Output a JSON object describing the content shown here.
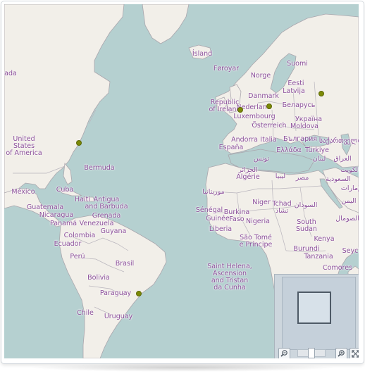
{
  "map": {
    "labels": [
      {
        "id": "island",
        "text": "Ísland"
      },
      {
        "id": "foroyar",
        "text": "Føroyar"
      },
      {
        "id": "norge",
        "text": "Norge"
      },
      {
        "id": "suomi",
        "text": "Suomi"
      },
      {
        "id": "eesti",
        "text": "Eesti"
      },
      {
        "id": "latvija",
        "text": "Latvija"
      },
      {
        "id": "danmark",
        "text": "Danmark"
      },
      {
        "id": "nederland",
        "text": "Nederland"
      },
      {
        "id": "belarus",
        "text": "Беларусь"
      },
      {
        "id": "ireland",
        "text": "Republic\nof Ireland"
      },
      {
        "id": "luxembourg",
        "text": "Luxembourg"
      },
      {
        "id": "ukraina",
        "text": "Україна"
      },
      {
        "id": "osterreich",
        "text": "Österreich"
      },
      {
        "id": "moldova",
        "text": "Moldova"
      },
      {
        "id": "bulgaria",
        "text": "България"
      },
      {
        "id": "andorra",
        "text": "Andorra"
      },
      {
        "id": "italia",
        "text": "Italia"
      },
      {
        "id": "georgia",
        "text": "საქართველო"
      },
      {
        "id": "espana",
        "text": "España"
      },
      {
        "id": "ellada",
        "text": "Ελλάδα"
      },
      {
        "id": "turkiye",
        "text": "Türkiye"
      },
      {
        "id": "tunisia",
        "text": "تونس"
      },
      {
        "id": "lebanon",
        "text": "لبنان"
      },
      {
        "id": "iraq",
        "text": "العراق"
      },
      {
        "id": "algeria",
        "text": "الجزائر\nAlgérie"
      },
      {
        "id": "libya",
        "text": "ليبيا"
      },
      {
        "id": "kuwait",
        "text": "الكويت"
      },
      {
        "id": "egypt",
        "text": "مصر"
      },
      {
        "id": "saudi",
        "text": "السعودية"
      },
      {
        "id": "morocco",
        "text": "موريتانيا"
      },
      {
        "id": "uae",
        "text": "الإمارات"
      },
      {
        "id": "yemen",
        "text": "اليمن"
      },
      {
        "id": "niger",
        "text": "Niger"
      },
      {
        "id": "tchad",
        "text": "Tchad\nتشاد"
      },
      {
        "id": "sudan",
        "text": "السودان"
      },
      {
        "id": "somalia",
        "text": "الصومال"
      },
      {
        "id": "senegal",
        "text": "Sénégal"
      },
      {
        "id": "burkina",
        "text": "Burkina\nFaso"
      },
      {
        "id": "guinee",
        "text": "Guinée"
      },
      {
        "id": "nigeria",
        "text": "Nigeria"
      },
      {
        "id": "liberia",
        "text": "Liberia"
      },
      {
        "id": "south_sudan",
        "text": "South\nSudan"
      },
      {
        "id": "kenya",
        "text": "Kenya"
      },
      {
        "id": "saotome",
        "text": "São Tomé\ne Príncipe"
      },
      {
        "id": "burundi",
        "text": "Burundi"
      },
      {
        "id": "tanzania",
        "text": "Tanzania"
      },
      {
        "id": "seychelles",
        "text": "Seych"
      },
      {
        "id": "comores",
        "text": "Comores"
      },
      {
        "id": "sainthelena",
        "text": "Saint Helena,\nAscension\nand Tristan\nda Cunha"
      },
      {
        "id": "canada_edge",
        "text": "nada"
      },
      {
        "id": "usa",
        "text": "United\nStates\nof America"
      },
      {
        "id": "bermuda",
        "text": "Bermuda"
      },
      {
        "id": "mexico",
        "text": "México"
      },
      {
        "id": "cuba",
        "text": "Cuba"
      },
      {
        "id": "haiti",
        "text": "Haiti"
      },
      {
        "id": "antigua",
        "text": "Antigua\nand Barbuda"
      },
      {
        "id": "guatemala",
        "text": "Guatemala"
      },
      {
        "id": "grenada",
        "text": "Grenada"
      },
      {
        "id": "nicaragua",
        "text": "Nicaragua"
      },
      {
        "id": "venezuela",
        "text": "Venezuela"
      },
      {
        "id": "panama",
        "text": "Panamá"
      },
      {
        "id": "guyana",
        "text": "Guyana"
      },
      {
        "id": "colombia",
        "text": "Colombia"
      },
      {
        "id": "ecuador",
        "text": "Ecuador"
      },
      {
        "id": "peru",
        "text": "Perú"
      },
      {
        "id": "brasil",
        "text": "Brasil"
      },
      {
        "id": "bolivia",
        "text": "Bolivia"
      },
      {
        "id": "paraguay",
        "text": "Paraguay"
      },
      {
        "id": "chile",
        "text": "Chile"
      },
      {
        "id": "uruguay",
        "text": "Uruguay"
      }
    ],
    "markers": [
      {
        "id": "marker-new-york"
      },
      {
        "id": "marker-dublin"
      },
      {
        "id": "marker-berlin"
      },
      {
        "id": "marker-moscow"
      },
      {
        "id": "marker-sao-paulo"
      }
    ],
    "colors": {
      "water": "#b5d0d0",
      "land": "#f2efe9",
      "border": "#a6a3ab",
      "label": "#8b4e9a",
      "marker": "#7c8a06"
    }
  },
  "overview": {
    "zoom_out_icon": "zoom-out-icon",
    "zoom_in_icon": "zoom-in-icon",
    "fullscreen_icon": "fullscreen-icon"
  }
}
